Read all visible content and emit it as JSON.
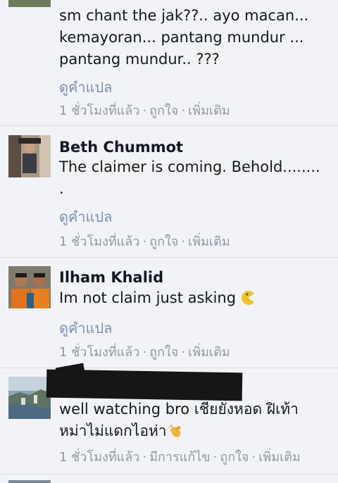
{
  "comments": [
    {
      "name": "",
      "text_lines": [
        "sm chant the jak??.. ayo macan...",
        "kemayoran... pantang mundur ...",
        "pantang mundur.. ???"
      ],
      "translate": "ดูคำแปล",
      "time": "1 ชั่วโมงที่แล้ว",
      "like": "ถูกใจ",
      "more": "เพิ่มเติม"
    },
    {
      "name": "Beth Chummot",
      "text_lines": [
        "The claimer is coming. Behold........",
        "."
      ],
      "translate": "ดูคำแปล",
      "time": "1 ชั่วโมงที่แล้ว",
      "like": "ถูกใจ",
      "more": "เพิ่มเติม"
    },
    {
      "name": "Ilham Khalid",
      "text_lines": [
        "Im not claim just asking"
      ],
      "emoji": "pacman-emoji",
      "translate": "ดูคำแปล",
      "time": "1 ชั่วโมงที่แล้ว",
      "like": "ถูกใจ",
      "more": "เพิ่มเติม"
    },
    {
      "name": "",
      "text_lines": [
        "well watching bro เชียยั่งหอด ฝิเท้า",
        "หม่าไม่แดกไอห่า"
      ],
      "emoji": "clapping-hands-emoji",
      "time": "1 ชั่วโมงที่แล้ว",
      "edited": "มีการแก้ไข",
      "like": "ถูกใจ",
      "more": "เพิ่มเติม"
    }
  ],
  "colors": {
    "background": "#f1f3f6",
    "text": "#141823",
    "link": "#7c8fb4",
    "meta": "#9197a3",
    "divider": "#dcdfe4"
  },
  "separator": "·"
}
